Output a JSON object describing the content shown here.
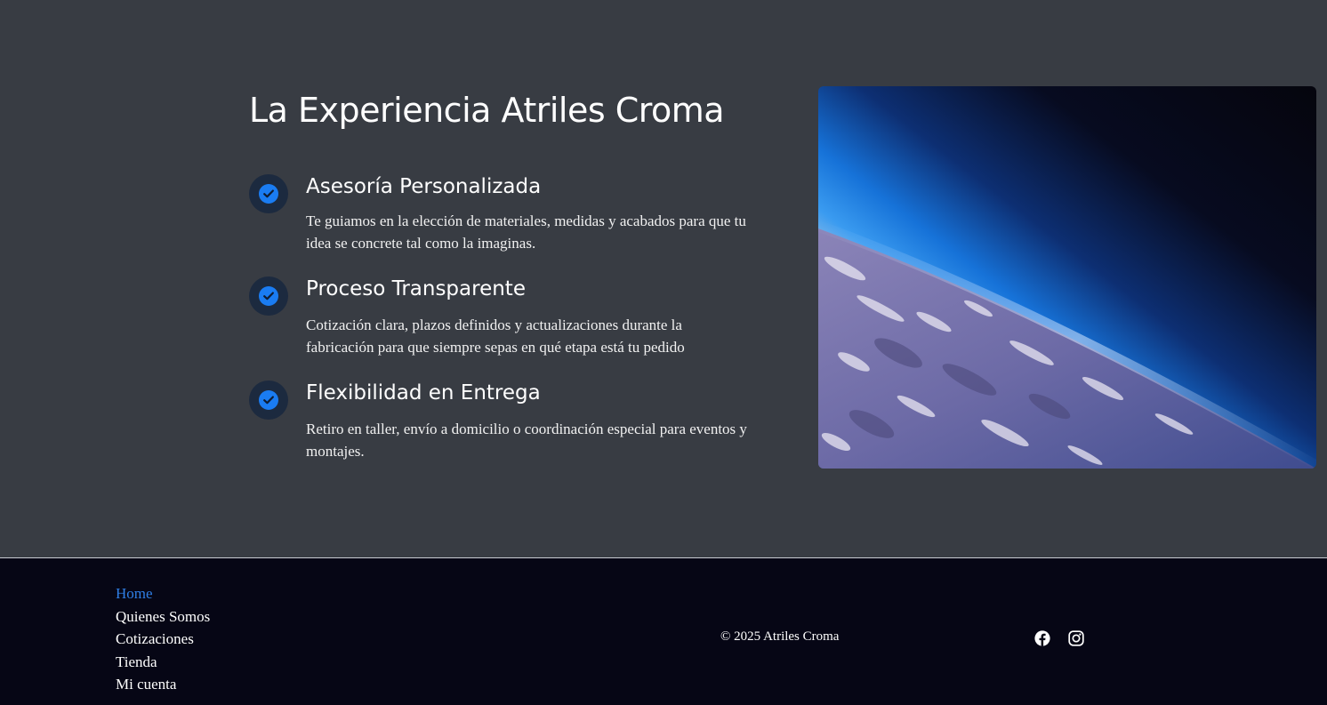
{
  "main": {
    "title": "La Experiencia Atriles Croma",
    "features": [
      {
        "heading": "Asesoría Personalizada",
        "text": "Te guiamos en la elección de materiales, medidas y acabados para que tu idea se concrete tal como la imaginas."
      },
      {
        "heading": "Proceso Transparente",
        "text": "Cotización clara, plazos definidos y actualizaciones durante la fabricación para que siempre sepas en qué etapa está tu pedido"
      },
      {
        "heading": "Flexibilidad en Entrega",
        "text": "Retiro en taller, envío a domicilio o coordinación especial para eventos y montajes."
      }
    ],
    "check_icon": "check-circle-icon",
    "image": "earth-from-space-photo"
  },
  "footer": {
    "nav": [
      "Home",
      "Quienes Somos",
      "Cotizaciones",
      "Tienda",
      "Mi cuenta"
    ],
    "active_index": 0,
    "copyright": "© 2025 Atriles Croma",
    "social_icons": [
      "facebook-icon",
      "instagram-icon"
    ]
  },
  "colors": {
    "background": "#383c43",
    "footer_background": "#060615",
    "accent": "#1a7cf2",
    "active_link": "#2f7fe6"
  }
}
